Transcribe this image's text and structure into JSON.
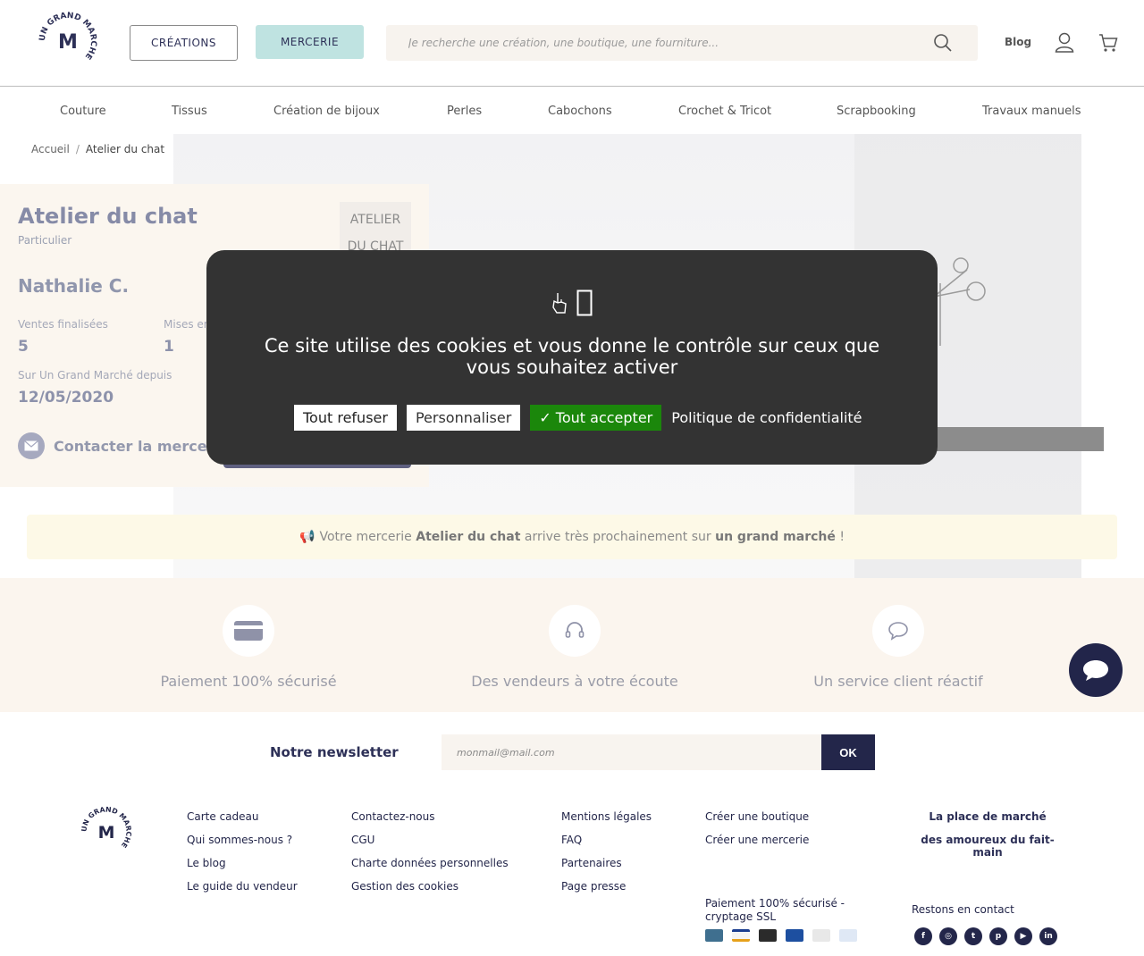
{
  "header": {
    "logo_alt": "Un Grand Marché",
    "creations_label": "CRÉATIONS",
    "mercerie_label": "MERCERIE",
    "search_placeholder": "Je recherche une création, une boutique, une fourniture...",
    "blog_label": "Blog",
    "icons": [
      "search-icon",
      "user-icon",
      "cart-icon"
    ]
  },
  "categories": [
    "Couture",
    "Tissus",
    "Création de bijoux",
    "Perles",
    "Cabochons",
    "Crochet & Tricot",
    "Scrapbooking",
    "Travaux manuels"
  ],
  "breadcrumb": {
    "home": "Accueil",
    "separator": "/",
    "current": "Atelier du chat"
  },
  "shop": {
    "name": "Atelier du chat",
    "type": "Particulier",
    "logo_text_1": "ATELIER",
    "logo_text_2": "DU CHAT",
    "owner": "Nathalie C.",
    "sales_label": "Ventes finalisées",
    "sales_value": "5",
    "listings_label": "Mises en",
    "listings_value": "1",
    "since_label": "Sur Un Grand Marché depuis",
    "since_value": "12/05/2020",
    "contact_label": "Contacter la merceri"
  },
  "announce": {
    "prefix": "Votre mercerie",
    "shop": "Atelier du chat",
    "middle": "arrive très prochainement sur",
    "brand": "un grand marché",
    "suffix": "!"
  },
  "features": [
    {
      "icon": "credit-card-icon",
      "label": "Paiement 100% sécurisé"
    },
    {
      "icon": "headset-icon",
      "label": "Des vendeurs à votre écoute"
    },
    {
      "icon": "speech-bubble-icon",
      "label": "Un service client réactif"
    }
  ],
  "newsletter": {
    "title": "Notre newsletter",
    "placeholder": "monmail@mail.com",
    "button": "OK"
  },
  "footer": {
    "col1": [
      "Carte cadeau",
      "Qui sommes-nous ?",
      "Le blog",
      "Le guide du vendeur"
    ],
    "col2": [
      "Contactez-nous",
      "CGU",
      "Charte données personnelles",
      "Gestion des cookies"
    ],
    "col3": [
      "Mentions légales",
      "FAQ",
      "Partenaires",
      "Page presse"
    ],
    "col4": [
      "Créer une boutique",
      "Créer une mercerie"
    ],
    "tagline_1": "La place de marché",
    "tagline_2": "des amoureux du fait-main",
    "payment_text": "Paiement 100% sécurisé - cryptage SSL",
    "contact_title": "Restons en contact",
    "socials": [
      "facebook-icon",
      "instagram-icon",
      "twitter-icon",
      "pinterest-icon",
      "youtube-icon",
      "linkedin-icon"
    ]
  },
  "cookie": {
    "message": "Ce site utilise des cookies et vous donne le contrôle sur ceux que vous souhaitez activer",
    "refuse": "Tout refuser",
    "customize": "Personnaliser",
    "accept": "✓ Tout accepter",
    "policy": "Politique de confidentialité"
  },
  "colors": {
    "navy": "#23264a",
    "mint": "#bfe3e1",
    "accept_green": "#1b870b",
    "modal_bg": "#333333"
  }
}
